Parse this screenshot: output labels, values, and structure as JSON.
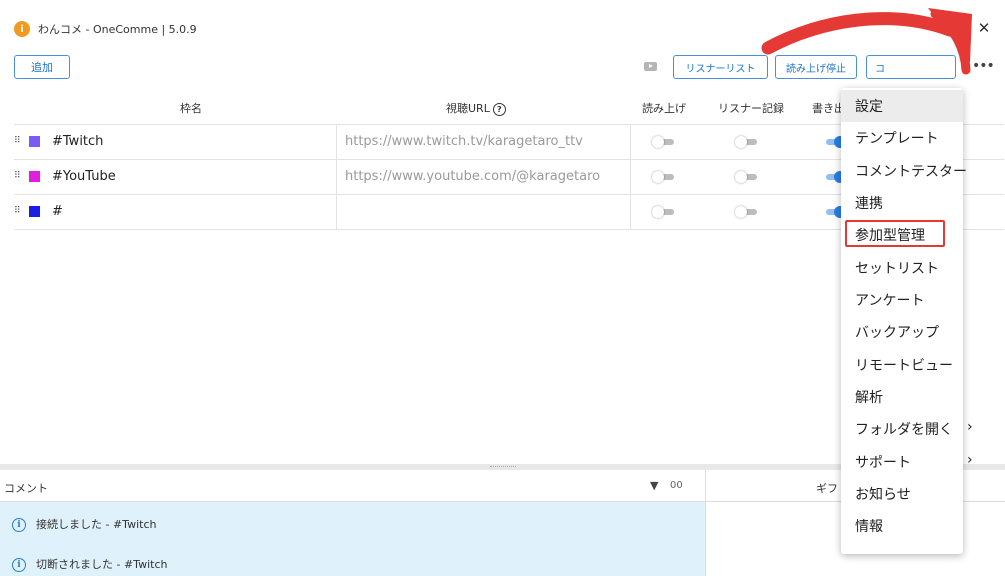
{
  "window": {
    "title": "わんコメ - OneComme | 5.0.9",
    "minimize_label": "□",
    "close_label": "✕"
  },
  "toolbar": {
    "add_label": "追加",
    "listener_list_label": "リスナーリスト",
    "stop_reading_label": "読み上げ停止",
    "comment_label": "コ"
  },
  "table": {
    "headers": {
      "frame_name": "枠名",
      "url": "視聴URL",
      "read_aloud": "読み上げ",
      "listener_record": "リスナー記録",
      "write_out": "書き出"
    },
    "rows": [
      {
        "name": "#Twitch",
        "color": "#7b5cf0",
        "url": "https://www.twitch.tv/karagetaro_ttv",
        "read_aloud": false,
        "listener_record": false,
        "write_out": true
      },
      {
        "name": "#YouTube",
        "color": "#e01ee0",
        "url": "https://www.youtube.com/@karagetaro",
        "read_aloud": false,
        "listener_record": false,
        "write_out": true
      },
      {
        "name": "#",
        "color": "#1a1ee6",
        "url": "",
        "read_aloud": false,
        "listener_record": false,
        "write_out": true
      }
    ]
  },
  "comments": {
    "title": "コメント",
    "count": "00",
    "items": [
      "接続しました - #Twitch",
      "切断されました - #Twitch"
    ]
  },
  "gift": {
    "title": "ギフ"
  },
  "menu": {
    "items": [
      {
        "label": "設定",
        "submenu": false
      },
      {
        "label": "テンプレート",
        "submenu": false
      },
      {
        "label": "コメントテスター",
        "submenu": false
      },
      {
        "label": "連携",
        "submenu": false
      },
      {
        "label": "参加型管理",
        "submenu": false
      },
      {
        "label": "セットリスト",
        "submenu": false
      },
      {
        "label": "アンケート",
        "submenu": false
      },
      {
        "label": "バックアップ",
        "submenu": false
      },
      {
        "label": "リモートビュー",
        "submenu": false
      },
      {
        "label": "解析",
        "submenu": false
      },
      {
        "label": "フォルダを開く",
        "submenu": true
      },
      {
        "label": "サポート",
        "submenu": true
      },
      {
        "label": "お知らせ",
        "submenu": false
      },
      {
        "label": "情報",
        "submenu": false
      }
    ],
    "highlighted_item": "参加型管理",
    "hovered_item": "設定"
  },
  "colors": {
    "accent": "#1a73c8",
    "annotation": "#e53935",
    "toggle_on": "#2a7de1",
    "comment_bg": "#dff1fb"
  }
}
